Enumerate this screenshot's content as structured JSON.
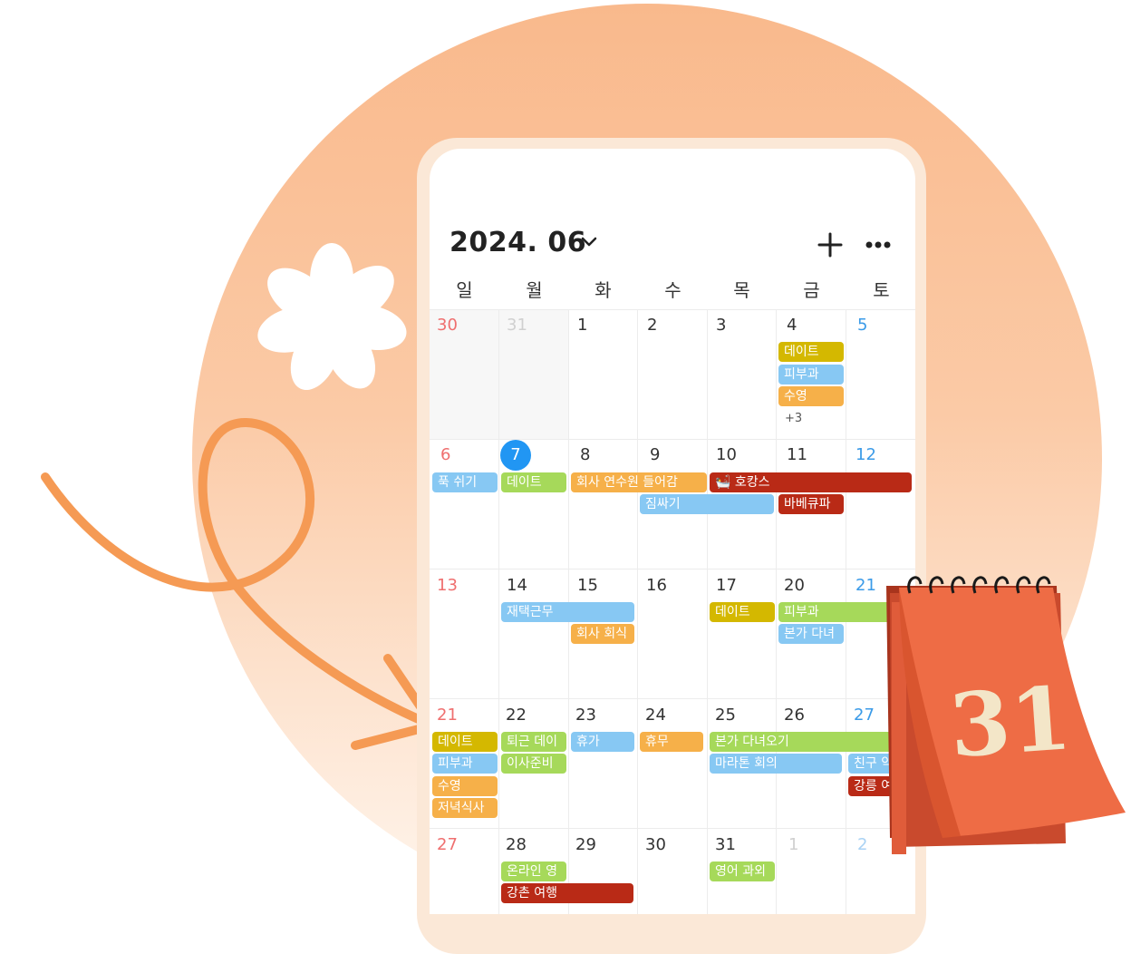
{
  "header": {
    "title": "2024. 06"
  },
  "weekdays": [
    "일",
    "월",
    "화",
    "수",
    "목",
    "금",
    "토"
  ],
  "weeks": [
    [
      "30",
      "31",
      "1",
      "2",
      "3",
      "4",
      "5"
    ],
    [
      "6",
      "7",
      "8",
      "9",
      "10",
      "11",
      "12"
    ],
    [
      "13",
      "14",
      "15",
      "16",
      "17",
      "20",
      "21"
    ],
    [
      "21",
      "22",
      "23",
      "24",
      "25",
      "26",
      "27"
    ],
    [
      "27",
      "28",
      "29",
      "30",
      "31",
      "1",
      "2"
    ]
  ],
  "events": {
    "w1": {
      "e1": "데이트",
      "e2": "피부과",
      "e3": "수영",
      "more": "+3"
    },
    "w2": {
      "e1": "푹 쉬기",
      "e2": "데이트",
      "e3": "회사 연수원 들어감",
      "e4": "🛀 호캉스",
      "e5": "짐싸기",
      "e6": "바베큐파"
    },
    "w3": {
      "e1": "재택근무",
      "e2": "회사 회식",
      "e3": "데이트",
      "e4": "피부과",
      "e5": "본가 다녀"
    },
    "w4": {
      "e1": "데이트",
      "e2": "피부과",
      "e3": "수영",
      "e4": "저녁식사",
      "e5": "퇴근 데이",
      "e6": "이사준비",
      "e7": "휴가",
      "e8": "휴무",
      "e9": "본가 다녀오기",
      "e10": "마라톤 회의",
      "e11": "친구 약",
      "e12": "강릉 여"
    },
    "w5": {
      "e1": "온라인 영",
      "e2": "강촌 여행",
      "e3": "영어 과외"
    }
  },
  "sticker": {
    "number": "31"
  },
  "colors": {
    "yellow": "#d4b800",
    "blue": "#87c8f3",
    "orange": "#f6b049",
    "green": "#a6d95a",
    "red": "#b92a16",
    "today": "#2196f3",
    "sunday": "#ef6f6f",
    "saturday": "#3b9be8",
    "accent": "#f08f4a"
  }
}
